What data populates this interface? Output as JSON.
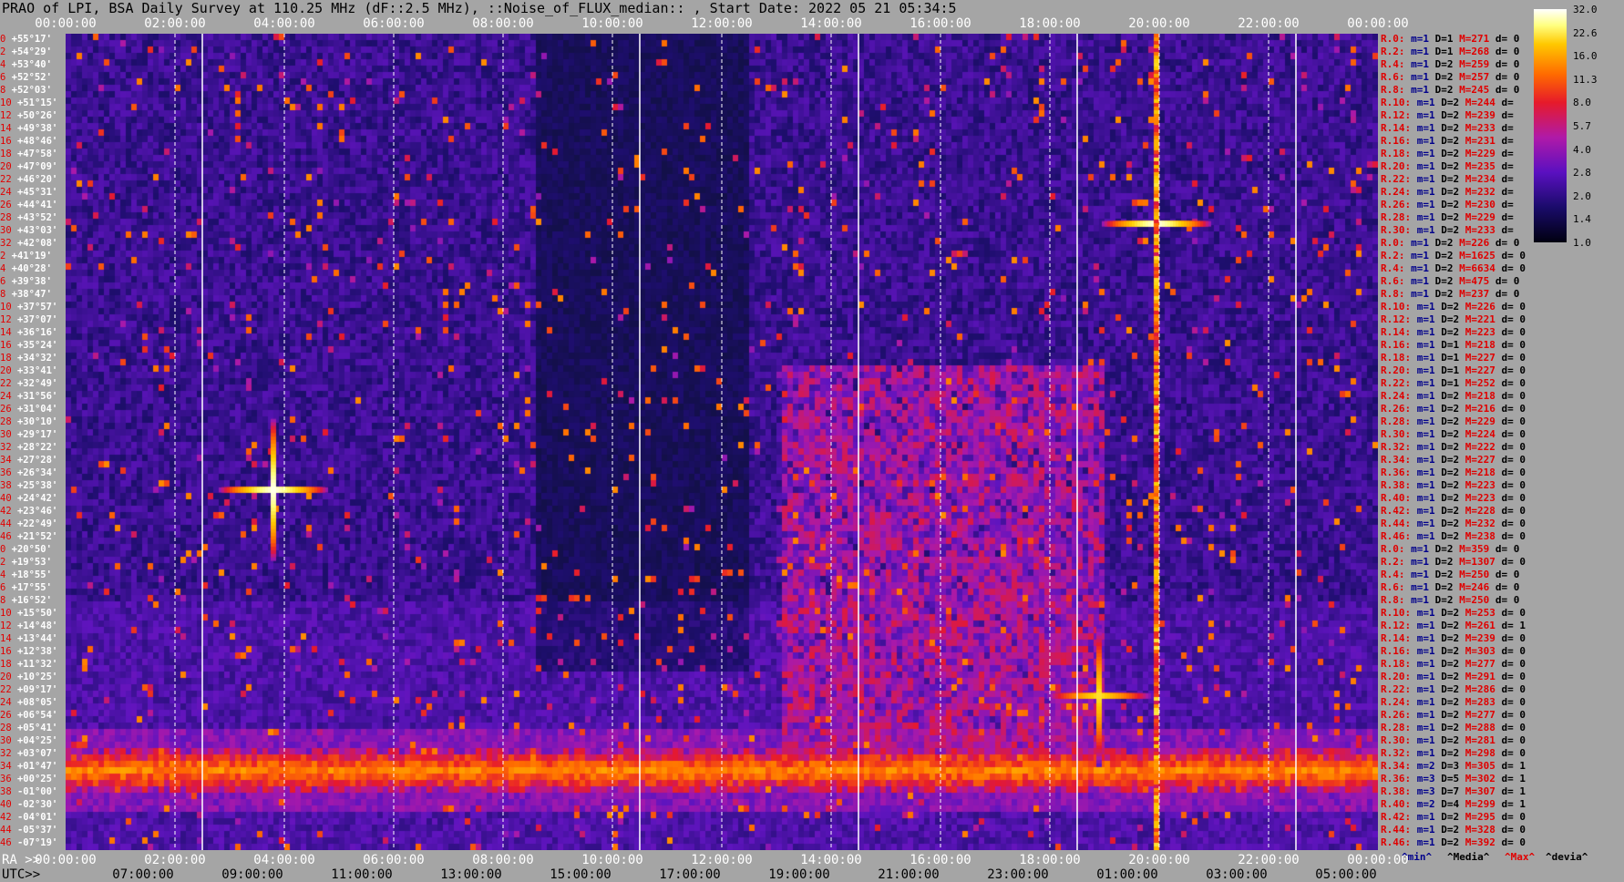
{
  "title": "PRAO of LPI, BSA Daily Survey at 110.25 MHz (dF::2.5 MHz), ::Noise_of_FLUX_median:: , Start Date: 2022 05 21 05:34:5",
  "axes": {
    "top_ticks": [
      "00:00:00",
      "02:00:00",
      "04:00:00",
      "06:00:00",
      "08:00:00",
      "10:00:00",
      "12:00:00",
      "14:00:00",
      "16:00:00",
      "18:00:00",
      "20:00:00",
      "22:00:00",
      "00:00:00"
    ],
    "ra_label": "RA >>",
    "ra_ticks": [
      "00:00:00",
      "02:00:00",
      "04:00:00",
      "06:00:00",
      "08:00:00",
      "10:00:00",
      "12:00:00",
      "14:00:00",
      "16:00:00",
      "18:00:00",
      "20:00:00",
      "22:00:00",
      "00:00:00"
    ],
    "utc_label": "UTC>>",
    "utc_ticks": [
      "07:00:00",
      "09:00:00",
      "11:00:00",
      "13:00:00",
      "15:00:00",
      "17:00:00",
      "19:00:00",
      "21:00:00",
      "23:00:00",
      "01:00:00",
      "03:00:00",
      "05:00:00"
    ]
  },
  "declinations": [
    {
      "idx": "0",
      "dec": "+55°17'"
    },
    {
      "idx": "2",
      "dec": "+54°29'"
    },
    {
      "idx": "4",
      "dec": "+53°40'"
    },
    {
      "idx": "6",
      "dec": "+52°52'"
    },
    {
      "idx": "8",
      "dec": "+52°03'"
    },
    {
      "idx": "10",
      "dec": "+51°15'"
    },
    {
      "idx": "12",
      "dec": "+50°26'"
    },
    {
      "idx": "14",
      "dec": "+49°38'"
    },
    {
      "idx": "16",
      "dec": "+48°46'"
    },
    {
      "idx": "18",
      "dec": "+47°58'"
    },
    {
      "idx": "20",
      "dec": "+47°09'"
    },
    {
      "idx": "22",
      "dec": "+46°20'"
    },
    {
      "idx": "24",
      "dec": "+45°31'"
    },
    {
      "idx": "26",
      "dec": "+44°41'"
    },
    {
      "idx": "28",
      "dec": "+43°52'"
    },
    {
      "idx": "30",
      "dec": "+43°03'"
    },
    {
      "idx": "32",
      "dec": "+42°08'"
    },
    {
      "idx": "2",
      "dec": "+41°19'"
    },
    {
      "idx": "4",
      "dec": "+40°28'"
    },
    {
      "idx": "6",
      "dec": "+39°38'"
    },
    {
      "idx": "8",
      "dec": "+38°47'"
    },
    {
      "idx": "10",
      "dec": "+37°57'"
    },
    {
      "idx": "12",
      "dec": "+37°07'"
    },
    {
      "idx": "14",
      "dec": "+36°16'"
    },
    {
      "idx": "16",
      "dec": "+35°24'"
    },
    {
      "idx": "18",
      "dec": "+34°32'"
    },
    {
      "idx": "20",
      "dec": "+33°41'"
    },
    {
      "idx": "22",
      "dec": "+32°49'"
    },
    {
      "idx": "24",
      "dec": "+31°56'"
    },
    {
      "idx": "26",
      "dec": "+31°04'"
    },
    {
      "idx": "28",
      "dec": "+30°10'"
    },
    {
      "idx": "30",
      "dec": "+29°17'"
    },
    {
      "idx": "32",
      "dec": "+28°22'"
    },
    {
      "idx": "34",
      "dec": "+27°28'"
    },
    {
      "idx": "36",
      "dec": "+26°34'"
    },
    {
      "idx": "38",
      "dec": "+25°38'"
    },
    {
      "idx": "40",
      "dec": "+24°42'"
    },
    {
      "idx": "42",
      "dec": "+23°46'"
    },
    {
      "idx": "44",
      "dec": "+22°49'"
    },
    {
      "idx": "46",
      "dec": "+21°52'"
    },
    {
      "idx": "0",
      "dec": "+20°50'"
    },
    {
      "idx": "2",
      "dec": "+19°53'"
    },
    {
      "idx": "4",
      "dec": "+18°55'"
    },
    {
      "idx": "6",
      "dec": "+17°55'"
    },
    {
      "idx": "8",
      "dec": "+16°52'"
    },
    {
      "idx": "10",
      "dec": "+15°50'"
    },
    {
      "idx": "12",
      "dec": "+14°48'"
    },
    {
      "idx": "14",
      "dec": "+13°44'"
    },
    {
      "idx": "16",
      "dec": "+12°38'"
    },
    {
      "idx": "18",
      "dec": "+11°32'"
    },
    {
      "idx": "20",
      "dec": "+10°25'"
    },
    {
      "idx": "22",
      "dec": "+09°17'"
    },
    {
      "idx": "24",
      "dec": "+08°05'"
    },
    {
      "idx": "26",
      "dec": "+06°54'"
    },
    {
      "idx": "28",
      "dec": "+05°41'"
    },
    {
      "idx": "30",
      "dec": "+04°25'"
    },
    {
      "idx": "32",
      "dec": "+03°07'"
    },
    {
      "idx": "34",
      "dec": "+01°47'"
    },
    {
      "idx": "36",
      "dec": "+00°25'"
    },
    {
      "idx": "38",
      "dec": "-01°00'"
    },
    {
      "idx": "40",
      "dec": "-02°30'"
    },
    {
      "idx": "42",
      "dec": "-04°01'"
    },
    {
      "idx": "44",
      "dec": "-05°37'"
    },
    {
      "idx": "46",
      "dec": "-07°19'"
    }
  ],
  "stats": [
    {
      "r": "R.0:",
      "m": "m=1",
      "D": "D=1",
      "M": "M=271",
      "d": "d= 0"
    },
    {
      "r": "R.2:",
      "m": "m=1",
      "D": "D=1",
      "M": "M=268",
      "d": "d= 0"
    },
    {
      "r": "R.4:",
      "m": "m=1",
      "D": "D=2",
      "M": "M=259",
      "d": "d= 0"
    },
    {
      "r": "R.6:",
      "m": "m=1",
      "D": "D=2",
      "M": "M=257",
      "d": "d= 0"
    },
    {
      "r": "R.8:",
      "m": "m=1",
      "D": "D=2",
      "M": "M=245",
      "d": "d= 0"
    },
    {
      "r": "R.10:",
      "m": "m=1",
      "D": "D=2",
      "M": "M=244",
      "d": "d="
    },
    {
      "r": "R.12:",
      "m": "m=1",
      "D": "D=2",
      "M": "M=239",
      "d": "d="
    },
    {
      "r": "R.14:",
      "m": "m=1",
      "D": "D=2",
      "M": "M=233",
      "d": "d="
    },
    {
      "r": "R.16:",
      "m": "m=1",
      "D": "D=2",
      "M": "M=231",
      "d": "d="
    },
    {
      "r": "R.18:",
      "m": "m=1",
      "D": "D=2",
      "M": "M=229",
      "d": "d="
    },
    {
      "r": "R.20:",
      "m": "m=1",
      "D": "D=2",
      "M": "M=235",
      "d": "d="
    },
    {
      "r": "R.22:",
      "m": "m=1",
      "D": "D=2",
      "M": "M=234",
      "d": "d="
    },
    {
      "r": "R.24:",
      "m": "m=1",
      "D": "D=2",
      "M": "M=232",
      "d": "d="
    },
    {
      "r": "R.26:",
      "m": "m=1",
      "D": "D=2",
      "M": "M=230",
      "d": "d="
    },
    {
      "r": "R.28:",
      "m": "m=1",
      "D": "D=2",
      "M": "M=229",
      "d": "d="
    },
    {
      "r": "R.30:",
      "m": "m=1",
      "D": "D=2",
      "M": "M=233",
      "d": "d="
    },
    {
      "r": "R.0:",
      "m": "m=1",
      "D": "D=2",
      "M": "M=226",
      "d": "d= 0"
    },
    {
      "r": "R.2:",
      "m": "m=1",
      "D": "D=2",
      "M": "M=1625",
      "d": "d= 0"
    },
    {
      "r": "R.4:",
      "m": "m=1",
      "D": "D=2",
      "M": "M=6634",
      "d": "d= 0"
    },
    {
      "r": "R.6:",
      "m": "m=1",
      "D": "D=2",
      "M": "M=475",
      "d": "d= 0"
    },
    {
      "r": "R.8:",
      "m": "m=1",
      "D": "D=2",
      "M": "M=237",
      "d": "d= 0"
    },
    {
      "r": "R.10:",
      "m": "m=1",
      "D": "D=2",
      "M": "M=226",
      "d": "d= 0"
    },
    {
      "r": "R.12:",
      "m": "m=1",
      "D": "D=2",
      "M": "M=221",
      "d": "d= 0"
    },
    {
      "r": "R.14:",
      "m": "m=1",
      "D": "D=2",
      "M": "M=223",
      "d": "d= 0"
    },
    {
      "r": "R.16:",
      "m": "m=1",
      "D": "D=1",
      "M": "M=218",
      "d": "d= 0"
    },
    {
      "r": "R.18:",
      "m": "m=1",
      "D": "D=1",
      "M": "M=227",
      "d": "d= 0"
    },
    {
      "r": "R.20:",
      "m": "m=1",
      "D": "D=1",
      "M": "M=227",
      "d": "d= 0"
    },
    {
      "r": "R.22:",
      "m": "m=1",
      "D": "D=1",
      "M": "M=252",
      "d": "d= 0"
    },
    {
      "r": "R.24:",
      "m": "m=1",
      "D": "D=2",
      "M": "M=218",
      "d": "d= 0"
    },
    {
      "r": "R.26:",
      "m": "m=1",
      "D": "D=2",
      "M": "M=216",
      "d": "d= 0"
    },
    {
      "r": "R.28:",
      "m": "m=1",
      "D": "D=2",
      "M": "M=229",
      "d": "d= 0"
    },
    {
      "r": "R.30:",
      "m": "m=1",
      "D": "D=2",
      "M": "M=224",
      "d": "d= 0"
    },
    {
      "r": "R.32:",
      "m": "m=1",
      "D": "D=2",
      "M": "M=222",
      "d": "d= 0"
    },
    {
      "r": "R.34:",
      "m": "m=1",
      "D": "D=2",
      "M": "M=227",
      "d": "d= 0"
    },
    {
      "r": "R.36:",
      "m": "m=1",
      "D": "D=2",
      "M": "M=218",
      "d": "d= 0"
    },
    {
      "r": "R.38:",
      "m": "m=1",
      "D": "D=2",
      "M": "M=223",
      "d": "d= 0"
    },
    {
      "r": "R.40:",
      "m": "m=1",
      "D": "D=2",
      "M": "M=223",
      "d": "d= 0"
    },
    {
      "r": "R.42:",
      "m": "m=1",
      "D": "D=2",
      "M": "M=228",
      "d": "d= 0"
    },
    {
      "r": "R.44:",
      "m": "m=1",
      "D": "D=2",
      "M": "M=232",
      "d": "d= 0"
    },
    {
      "r": "R.46:",
      "m": "m=1",
      "D": "D=2",
      "M": "M=238",
      "d": "d= 0"
    },
    {
      "r": "R.0:",
      "m": "m=1",
      "D": "D=2",
      "M": "M=359",
      "d": "d= 0"
    },
    {
      "r": "R.2:",
      "m": "m=1",
      "D": "D=2",
      "M": "M=1307",
      "d": "d= 0"
    },
    {
      "r": "R.4:",
      "m": "m=1",
      "D": "D=2",
      "M": "M=250",
      "d": "d= 0"
    },
    {
      "r": "R.6:",
      "m": "m=1",
      "D": "D=2",
      "M": "M=246",
      "d": "d= 0"
    },
    {
      "r": "R.8:",
      "m": "m=1",
      "D": "D=2",
      "M": "M=250",
      "d": "d= 0"
    },
    {
      "r": "R.10:",
      "m": "m=1",
      "D": "D=2",
      "M": "M=253",
      "d": "d= 0"
    },
    {
      "r": "R.12:",
      "m": "m=1",
      "D": "D=2",
      "M": "M=261",
      "d": "d= 1"
    },
    {
      "r": "R.14:",
      "m": "m=1",
      "D": "D=2",
      "M": "M=239",
      "d": "d= 0"
    },
    {
      "r": "R.16:",
      "m": "m=1",
      "D": "D=2",
      "M": "M=303",
      "d": "d= 0"
    },
    {
      "r": "R.18:",
      "m": "m=1",
      "D": "D=2",
      "M": "M=277",
      "d": "d= 0"
    },
    {
      "r": "R.20:",
      "m": "m=1",
      "D": "D=2",
      "M": "M=291",
      "d": "d= 0"
    },
    {
      "r": "R.22:",
      "m": "m=1",
      "D": "D=2",
      "M": "M=286",
      "d": "d= 0"
    },
    {
      "r": "R.24:",
      "m": "m=1",
      "D": "D=2",
      "M": "M=283",
      "d": "d= 0"
    },
    {
      "r": "R.26:",
      "m": "m=1",
      "D": "D=2",
      "M": "M=277",
      "d": "d= 0"
    },
    {
      "r": "R.28:",
      "m": "m=1",
      "D": "D=2",
      "M": "M=288",
      "d": "d= 0"
    },
    {
      "r": "R.30:",
      "m": "m=1",
      "D": "D=2",
      "M": "M=281",
      "d": "d= 0"
    },
    {
      "r": "R.32:",
      "m": "m=1",
      "D": "D=2",
      "M": "M=298",
      "d": "d= 0"
    },
    {
      "r": "R.34:",
      "m": "m=2",
      "D": "D=3",
      "M": "M=305",
      "d": "d= 1"
    },
    {
      "r": "R.36:",
      "m": "m=3",
      "D": "D=5",
      "M": "M=302",
      "d": "d= 1"
    },
    {
      "r": "R.38:",
      "m": "m=3",
      "D": "D=7",
      "M": "M=307",
      "d": "d= 1"
    },
    {
      "r": "R.40:",
      "m": "m=2",
      "D": "D=4",
      "M": "M=299",
      "d": "d= 1"
    },
    {
      "r": "R.42:",
      "m": "m=1",
      "D": "D=2",
      "M": "M=295",
      "d": "d= 0"
    },
    {
      "r": "R.44:",
      "m": "m=1",
      "D": "D=2",
      "M": "M=328",
      "d": "d= 0"
    },
    {
      "r": "R.46:",
      "m": "m=1",
      "D": "D=2",
      "M": "M=392",
      "d": "d= 0"
    }
  ],
  "legend": {
    "min": "^min^",
    "median": "^Media^",
    "max": "^Max^",
    "devia": "^devia^"
  },
  "colorbar": {
    "ticks": [
      "32.0",
      "22.6",
      "16.0",
      "11.3",
      "8.0",
      "5.7",
      "4.0",
      "2.8",
      "2.0",
      "1.4",
      "1.0"
    ]
  },
  "colors": {
    "background": "#a5a5a5",
    "low": "#101040",
    "mid": "#7a18c8",
    "high": "#ff2020",
    "peak": "#ffff60",
    "stat_red": "#e00000",
    "stat_blue": "#00008b"
  },
  "chart_data": {
    "type": "heatmap",
    "title": "PRAO of LPI, BSA Daily Survey at 110.25 MHz (dF::2.5 MHz), ::Noise_of_FLUX_median:: , Start Date: 2022 05 21 05:34:5",
    "x_axis": {
      "label": "RA >>",
      "range_hours": [
        0,
        24
      ],
      "ticks": [
        "00:00:00",
        "02:00:00",
        "04:00:00",
        "06:00:00",
        "08:00:00",
        "10:00:00",
        "12:00:00",
        "14:00:00",
        "16:00:00",
        "18:00:00",
        "20:00:00",
        "22:00:00",
        "00:00:00"
      ]
    },
    "x2_axis": {
      "label": "UTC>>",
      "ticks": [
        "07:00:00",
        "09:00:00",
        "11:00:00",
        "13:00:00",
        "15:00:00",
        "17:00:00",
        "19:00:00",
        "21:00:00",
        "23:00:00",
        "01:00:00",
        "03:00:00",
        "05:00:00"
      ]
    },
    "y_axis": {
      "range_dec_deg": [
        55.28,
        -7.32
      ]
    },
    "colorscale": {
      "min": 1.0,
      "max": 32.0,
      "scale": "log2"
    },
    "features": [
      {
        "kind": "point_source",
        "ra_hours": 3.8,
        "dec_deg": 20.3,
        "value": 32
      },
      {
        "kind": "point_source",
        "ra_hours": 19.95,
        "dec_deg": 40.7,
        "value": 32
      },
      {
        "kind": "point_source",
        "ra_hours": 18.9,
        "dec_deg": 4.5,
        "value": 22
      },
      {
        "kind": "band",
        "dec_deg": -1.0,
        "value": 11
      },
      {
        "kind": "interference_region",
        "ra_hours": [
          13,
          19
        ],
        "dec_deg": [
          0,
          30
        ],
        "value": 6
      }
    ]
  }
}
